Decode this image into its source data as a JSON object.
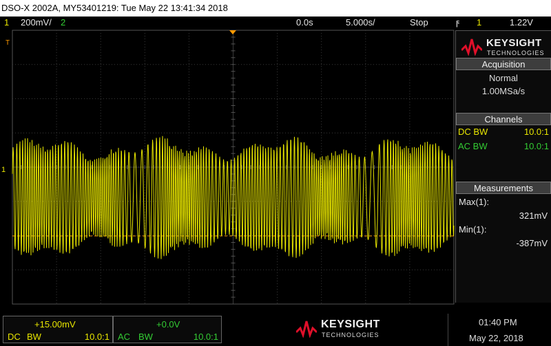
{
  "titlebar": {
    "text": "DSO-X 2002A, MY53401219: Tue May 22 13:41:34 2018"
  },
  "toprow": {
    "ch1_num": "1",
    "ch1_scale": "200mV/",
    "ch2_num": "2",
    "time_delay": "0.0s",
    "time_scale": "5.000s/",
    "run_state": "Stop",
    "trigger_symbol": "ϝ",
    "trigger_source": "1",
    "trigger_level": "1.22V"
  },
  "brand": {
    "name": "KEYSIGHT",
    "sub": "TECHNOLOGIES"
  },
  "acquisition": {
    "heading": "Acquisition",
    "mode": "Normal",
    "rate": "1.00MSa/s"
  },
  "channels": {
    "heading": "Channels",
    "rows": [
      {
        "label": "DC BW",
        "probe": "10.0:1",
        "color": "#e8e600"
      },
      {
        "label": "AC BW",
        "probe": "10.0:1",
        "color": "#33cc33"
      }
    ]
  },
  "measurements": {
    "heading": "Measurements",
    "items": [
      {
        "label": "Max(1):",
        "value": "321mV"
      },
      {
        "label": "Min(1):",
        "value": "-387mV"
      }
    ]
  },
  "bottom": {
    "ch1": {
      "offset": "+15.00mV",
      "coupling": "DC",
      "bw": "BW",
      "probe": "10.0:1"
    },
    "ch2": {
      "offset": "+0.0V",
      "coupling": "AC",
      "bw": "BW",
      "probe": "10.0:1"
    },
    "time": "01:40 PM",
    "date": "May 22, 2018"
  },
  "markers": {
    "trigger_marker": "T",
    "ch1_marker": "1"
  },
  "colors": {
    "ch1": "#e8e600",
    "ch2": "#33cc33",
    "trigger_line": "#ff9a00",
    "grid": "#3a3a3a",
    "brand_red": "#e0102a"
  }
}
